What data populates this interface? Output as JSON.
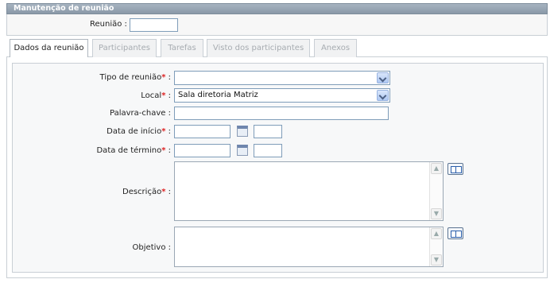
{
  "panel": {
    "title": "Manutenção de reunião"
  },
  "top": {
    "reuniao_label": "Reunião",
    "reuniao_value": ""
  },
  "tabs": [
    {
      "label": "Dados da reunião",
      "active": true
    },
    {
      "label": "Participantes",
      "active": false
    },
    {
      "label": "Tarefas",
      "active": false
    },
    {
      "label": "Visto dos participantes",
      "active": false
    },
    {
      "label": "Anexos",
      "active": false
    }
  ],
  "form": {
    "tipo_label": "Tipo de reunião",
    "tipo_value": "",
    "local_label": "Local",
    "local_value": "Sala diretoria Matriz",
    "palavra_label": "Palavra-chave",
    "palavra_value": "",
    "inicio_label": "Data de início",
    "termino_label": "Data de término",
    "descricao_label": "Descrição",
    "objetivo_label": "Objetivo",
    "required_mark": "*",
    "colon": ":"
  },
  "icons": {
    "calendar": "calendar-icon",
    "book": "book-icon",
    "dropdown": "chevron-down-icon"
  },
  "colors": {
    "required": "#dd2222",
    "header": "#93a2b1"
  }
}
